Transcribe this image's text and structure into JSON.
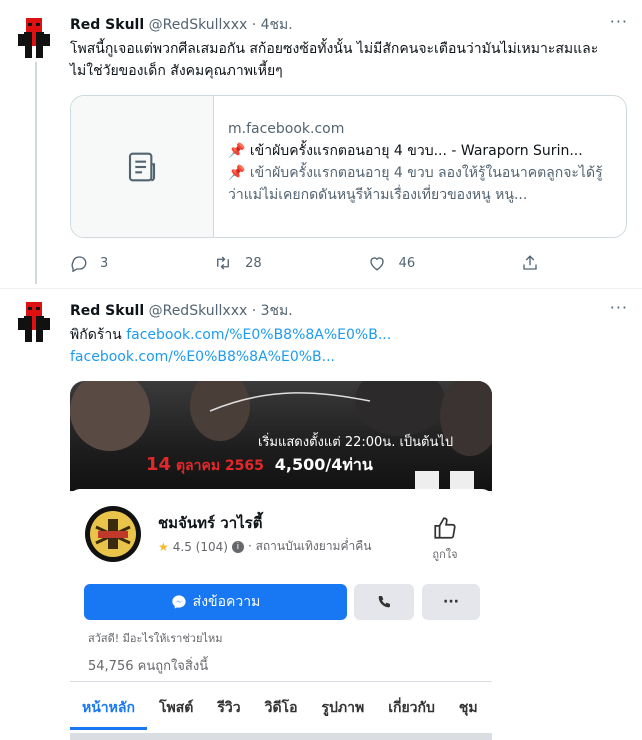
{
  "tweet1": {
    "name": "Red Skull",
    "handle": "@RedSkullxxx",
    "time": "· 4ชม.",
    "text": "โพสนี้กูเจอแต่พวกศีลเสมอกัน สก้อยซงซ้อทั้งนั้น ไม่มีสักคนจะเตือนว่ามันไม่เหมาะสมและไม่ใช่วัยของเด็ก สังคมคุณภาพเหี้ยๆ",
    "card": {
      "domain": "m.facebook.com",
      "title": "📌 เข้าผับครั้งแรกตอนอายุ 4 ขวบ... - Waraporn Surin...",
      "desc": "📌 เข้าผับครั้งแรกตอนอายุ 4 ขวบ ลองให้รู้ในอนาคตลูกจะได้รู้ว่าแม่ไม่เคยกดดันหนูรีห้ามเรื่องเที่ยวของหนู หนู..."
    },
    "replies": "3",
    "retweets": "28",
    "likes": "46"
  },
  "tweet2": {
    "name": "Red Skull",
    "handle": "@RedSkullxxx",
    "time": "· 3ชม.",
    "text_prefix": "พิกัดร้าน ",
    "link1": "facebook.com/%E0%B8%8A%E0%B...",
    "link2": "facebook.com/%E0%B8%8A%E0%B..."
  },
  "fb": {
    "banner_line1": "เริ่มแสดงตั้งแต่ 22:00น. เป็นต้นไป",
    "banner_date_num": "14",
    "banner_date": "ตุลาคม 2565",
    "banner_price": "4,500/4ท่าน",
    "page_name": "ชมจันทร์ วาไรตี้",
    "rating": "4.5 (104)",
    "category": "· สถานบันเทิงยามค่ำคืน",
    "like_label": "ถูกใจ",
    "message_btn": "ส่งข้อความ",
    "greeting": "สวัสดี! มีอะไรให้เราช่วยไหม",
    "likes_text": "54,756 คนถูกใจสิ่งนี้",
    "tabs": [
      "หน้าหลัก",
      "โพสต์",
      "รีวิว",
      "วิดีโอ",
      "รูปภาพ",
      "เกี่ยวกับ",
      "ชุม"
    ]
  },
  "colors": {
    "accent": "#1d9bf0",
    "fb_blue": "#1877f2",
    "banner_red": "#e4282a"
  },
  "icons": [
    "avatar-red-skull",
    "more-icon",
    "article-icon",
    "reply-icon",
    "retweet-icon",
    "like-icon",
    "share-icon",
    "messenger-icon",
    "phone-icon",
    "thumbs-up-icon",
    "star-icon",
    "info-icon"
  ]
}
